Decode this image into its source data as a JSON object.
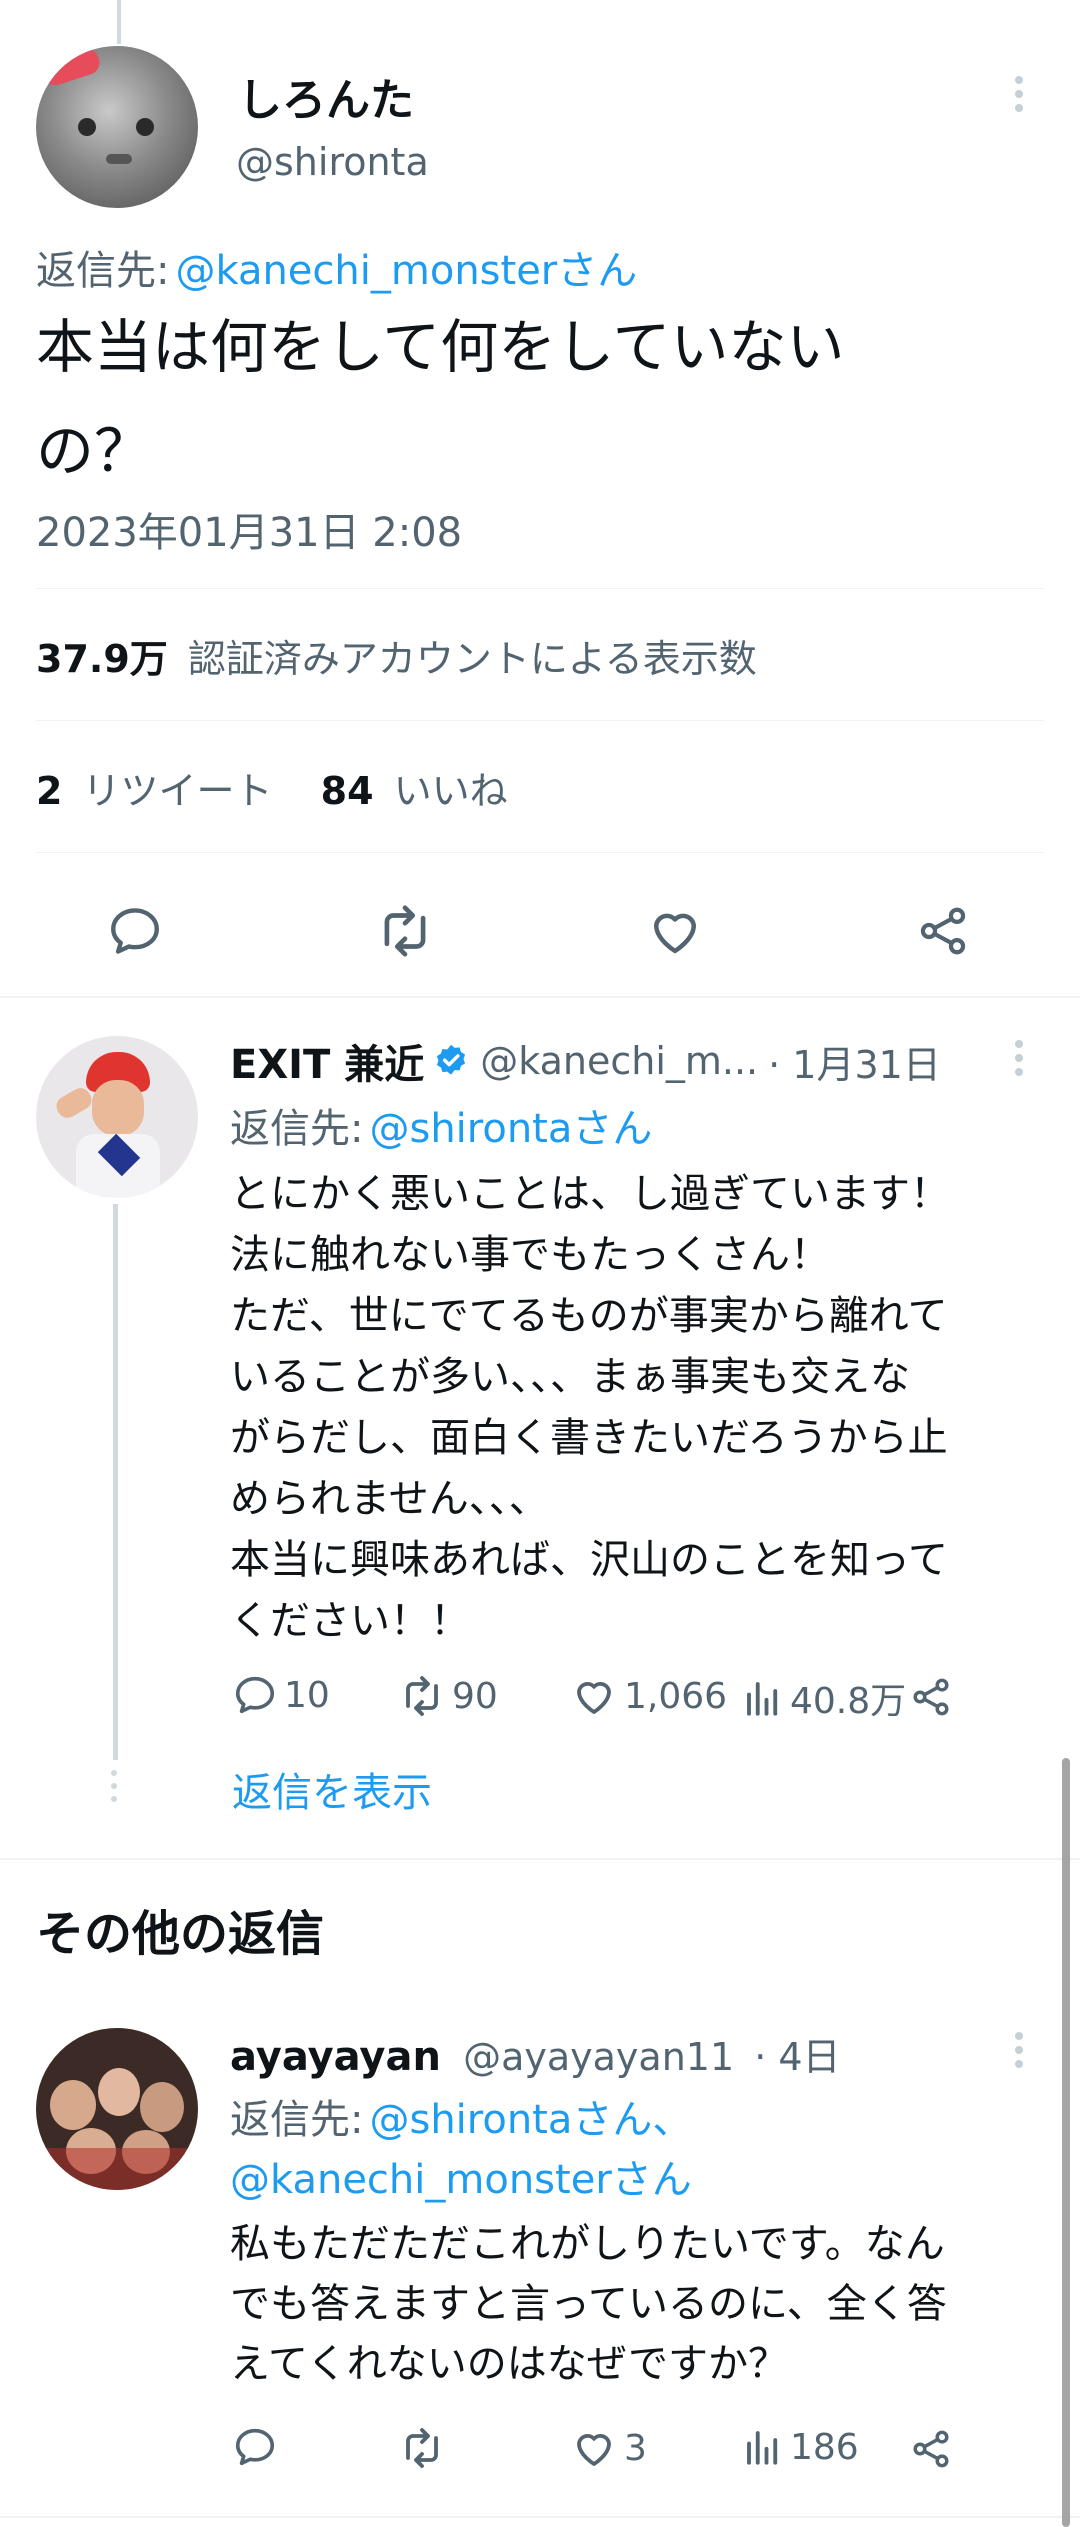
{
  "main_tweet": {
    "display_name": "しろんた",
    "handle": "@shironta",
    "reply_prefix": "返信先:",
    "reply_to": "@kanechi_monsterさん",
    "text_line1": "本当は何をして何をしていない",
    "text_line2": "の？",
    "timestamp": "2023年01月31日 2:08",
    "views_count": "37.9万",
    "views_label": "認証済みアカウントによる表示数",
    "retweets_count": "2",
    "retweets_label": "リツイート",
    "likes_count": "84",
    "likes_label": "いいね"
  },
  "reply1": {
    "display_name": "EXIT 兼近",
    "handle": "@kanechi_m...",
    "date": "· 1月31日",
    "reply_prefix": "返信先:",
    "reply_to": "@shirontaさん",
    "lines": [
      "とにかく悪いことは、し過ぎています！",
      "法に触れない事でもたっくさん！",
      "ただ、世にでてるものが事実から離れて",
      "いることが多い、、、まぁ事実も交えな",
      "がらだし、面白く書きたいだろうから止",
      "められません、、、",
      "本当に興味あれば、沢山のことを知って",
      "ください！！"
    ],
    "replies": "10",
    "retweets": "90",
    "likes": "1,066",
    "views": "40.8万",
    "show_replies": "返信を表示"
  },
  "section_title": "その他の返信",
  "reply2": {
    "display_name": "ayayayan",
    "handle": "@ayayayan11",
    "date": "· 4日",
    "reply_prefix": "返信先:",
    "reply_to_1": "@shirontaさん、",
    "reply_to_2": "@kanechi_monsterさん",
    "lines": [
      "私もただただこれがしりたいです。なん",
      "でも答えますと言っているのに、全く答",
      "えてくれないのはなぜですか？"
    ],
    "replies": "",
    "retweets": "",
    "likes": "3",
    "views": "186"
  },
  "colors": {
    "accent": "#1d9bf0",
    "muted": "#536471",
    "text": "#0f1419",
    "divider": "#eff3f4"
  }
}
